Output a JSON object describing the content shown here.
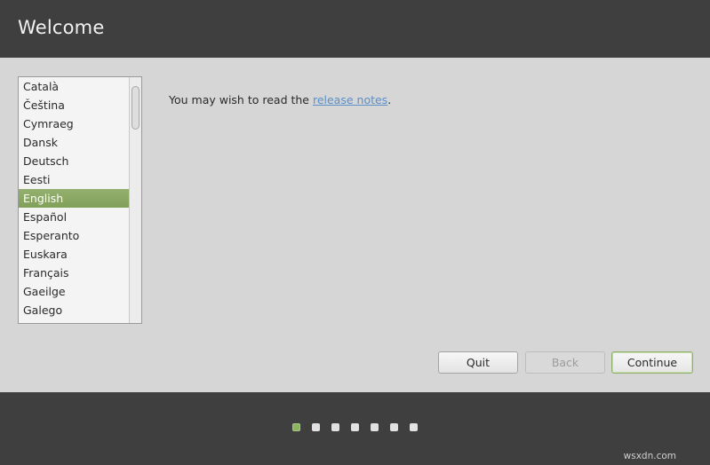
{
  "header": {
    "title": "Welcome"
  },
  "languages": {
    "items": [
      {
        "label": "Català"
      },
      {
        "label": "Čeština"
      },
      {
        "label": "Cymraeg"
      },
      {
        "label": "Dansk"
      },
      {
        "label": "Deutsch"
      },
      {
        "label": "Eesti"
      },
      {
        "label": "English",
        "selected": true
      },
      {
        "label": "Español"
      },
      {
        "label": "Esperanto"
      },
      {
        "label": "Euskara"
      },
      {
        "label": "Français"
      },
      {
        "label": "Gaeilge"
      },
      {
        "label": "Galego"
      }
    ],
    "selected": "English"
  },
  "release": {
    "prefix": "You may wish to read the ",
    "link_text": "release notes",
    "suffix": "."
  },
  "buttons": {
    "quit": "Quit",
    "back": "Back",
    "continue": "Continue"
  },
  "progress": {
    "total_steps": 7,
    "current_step": 1
  },
  "watermark": "wsxdn.com",
  "colors": {
    "header_bg": "#3f3f3f",
    "content_bg": "#d6d6d6",
    "accent_green": "#8db35f",
    "link_blue": "#5a8fc7"
  }
}
